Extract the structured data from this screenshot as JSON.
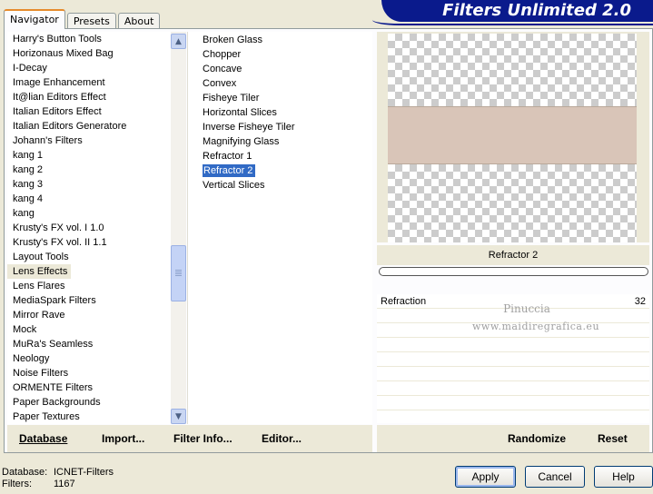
{
  "tabs": [
    {
      "label": "Navigator",
      "active": true
    },
    {
      "label": "Presets",
      "active": false
    },
    {
      "label": "About",
      "active": false
    }
  ],
  "banner": {
    "title": "Filters Unlimited 2.0",
    "color": "#0a1a8c"
  },
  "categories": {
    "items": [
      "Harry's Button Tools",
      "Horizonaus Mixed Bag",
      "I-Decay",
      "Image Enhancement",
      "It@lian Editors Effect",
      "Italian Editors Effect",
      "Italian Editors Generatore",
      "Johann's Filters",
      "kang 1",
      "kang 2",
      "kang 3",
      "kang 4",
      "kang",
      "Krusty's FX vol. I 1.0",
      "Krusty's FX vol. II 1.1",
      "Layout Tools",
      "Lens Effects",
      "Lens Flares",
      "MediaSpark Filters",
      "Mirror Rave",
      "Mock",
      "MuRa's Seamless",
      "Neology",
      "Noise Filters",
      "ORMENTE Filters",
      "Paper Backgrounds",
      "Paper Textures"
    ],
    "selected": "Lens Effects",
    "scroll_up_icon": "chevron-up-icon",
    "scroll_down_icon": "chevron-down-icon"
  },
  "filters": {
    "items": [
      "Broken Glass",
      "Chopper",
      "Concave",
      "Convex",
      "Fisheye Tiler",
      "Horizontal Slices",
      "Inverse Fisheye Tiler",
      "Magnifying Glass",
      "Refractor 1",
      "Refractor 2",
      "Vertical Slices"
    ],
    "selected": "Refractor 2",
    "selection_color": "#316ac5"
  },
  "preview": {
    "band_color": "#d9c5b8",
    "effect_name": "Refractor 2",
    "progress": 0
  },
  "params": [
    {
      "name": "Refraction",
      "value": "32"
    }
  ],
  "watermark": {
    "line1": "Pinuccia",
    "line2": "www.maidiregrafica.eu"
  },
  "links_left": {
    "database": "Database",
    "import": "Import...",
    "filter_info": "Filter Info...",
    "editor": "Editor..."
  },
  "links_right": {
    "randomize": "Randomize",
    "reset": "Reset"
  },
  "status": {
    "database_label": "Database:",
    "database_value": "ICNET-Filters",
    "filters_label": "Filters:",
    "filters_value": "1167"
  },
  "buttons": {
    "apply": "Apply",
    "cancel": "Cancel",
    "help": "Help"
  }
}
